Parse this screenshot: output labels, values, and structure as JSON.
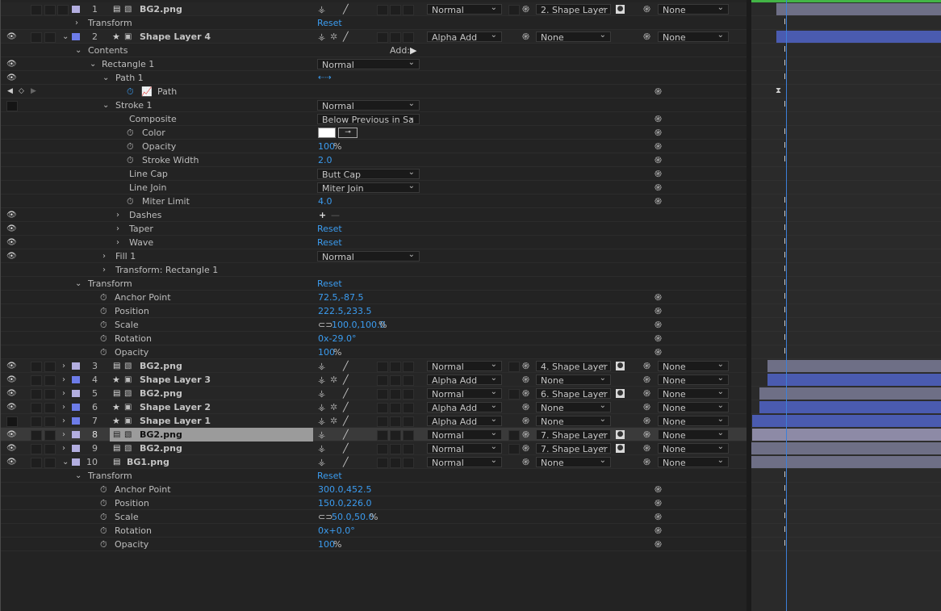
{
  "labels": {
    "transform": "Transform",
    "contents": "Contents",
    "add": "Add:",
    "reset": "Reset",
    "rectangle": "Rectangle 1",
    "path_group": "Path 1",
    "path": "Path",
    "stroke": "Stroke 1",
    "composite": "Composite",
    "color": "Color",
    "opacity": "Opacity",
    "stroke_width": "Stroke Width",
    "line_cap": "Line Cap",
    "line_join": "Line Join",
    "miter_limit": "Miter Limit",
    "dashes": "Dashes",
    "taper": "Taper",
    "wave": "Wave",
    "fill": "Fill 1",
    "transform_rect": "Transform: Rectangle 1",
    "anchor_point": "Anchor Point",
    "position": "Position",
    "scale": "Scale",
    "rotation": "Rotation"
  },
  "modes": {
    "normal": "Normal",
    "alpha_add": "Alpha Add",
    "none": "None",
    "below_previous": "Below Previous in Sa",
    "butt_cap": "Butt Cap",
    "miter_join": "Miter Join"
  },
  "layers": [
    {
      "num": "1",
      "name": "BG2.png",
      "mode": "Normal",
      "parent": "2. Shape Layer",
      "track": "None",
      "color": "#b3aee0",
      "kind": "file"
    },
    {
      "num": "2",
      "name": "Shape Layer 4",
      "mode": "Alpha Add",
      "parent": "None",
      "track": "None",
      "color": "#6d7ce8",
      "kind": "shape"
    },
    {
      "num": "3",
      "name": "BG2.png",
      "mode": "Normal",
      "parent": "4. Shape Layer",
      "track": "None",
      "color": "#b3aee0",
      "kind": "file"
    },
    {
      "num": "4",
      "name": "Shape Layer 3",
      "mode": "Alpha Add",
      "parent": "None",
      "track": "None",
      "color": "#6d7ce8",
      "kind": "shape"
    },
    {
      "num": "5",
      "name": "BG2.png",
      "mode": "Normal",
      "parent": "6. Shape Layer",
      "track": "None",
      "color": "#b3aee0",
      "kind": "file"
    },
    {
      "num": "6",
      "name": "Shape Layer 2",
      "mode": "Alpha Add",
      "parent": "None",
      "track": "None",
      "color": "#6d7ce8",
      "kind": "shape"
    },
    {
      "num": "7",
      "name": "Shape Layer 1",
      "mode": "Alpha Add",
      "parent": "None",
      "track": "None",
      "color": "#6d7ce8",
      "kind": "shape"
    },
    {
      "num": "8",
      "name": "BG2.png",
      "mode": "Normal",
      "parent": "7. Shape Layer",
      "track": "None",
      "color": "#b3aee0",
      "kind": "file"
    },
    {
      "num": "9",
      "name": "BG2.png",
      "mode": "Normal",
      "parent": "7. Shape Layer",
      "track": "None",
      "color": "#b3aee0",
      "kind": "file"
    },
    {
      "num": "10",
      "name": "BG1.png",
      "mode": "Normal",
      "parent": "None",
      "track": "None",
      "color": "#b3aee0",
      "kind": "file"
    }
  ],
  "layer2": {
    "stroke_opacity": "100",
    "stroke_width": "2.0",
    "miter_limit": "4.0",
    "anchor_point": "72.5,-87.5",
    "position": "222.5,233.5",
    "scale": "100.0,100.0",
    "rotation": "0x-29.0°",
    "opacity": "100"
  },
  "layer10": {
    "anchor_point": "300.0,452.5",
    "position": "150.0,226.0",
    "scale": "50.0,50.0",
    "rotation": "0x+0.0°",
    "opacity": "100"
  },
  "units": {
    "percent": "%"
  },
  "colors": {
    "accent_blue": "#3b9cf0",
    "shape_bar": "#4a5bb0",
    "file_bar": "#6e6f86",
    "playhead": "#3d7fd9",
    "work_area": "#43b446"
  }
}
